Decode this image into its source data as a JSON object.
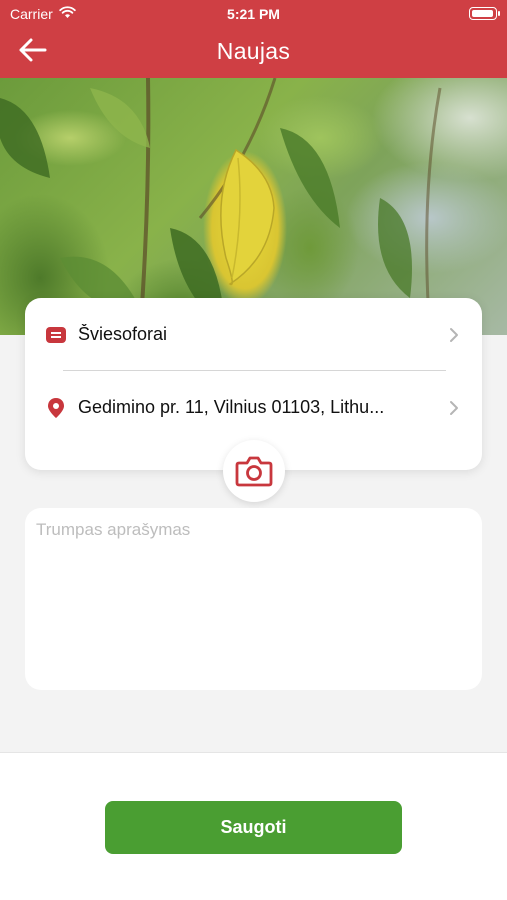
{
  "status_bar": {
    "carrier": "Carrier",
    "time": "5:21 PM",
    "battery_level": 1.0
  },
  "header": {
    "title": "Naujas",
    "back_icon": "arrow-left-icon",
    "background_color": "#cf3f44"
  },
  "hero": {
    "image_subject": "green leaves with yellow leaf"
  },
  "form": {
    "category": {
      "icon": "category-tag-icon",
      "value": "Šviesoforai"
    },
    "address": {
      "icon": "location-pin-icon",
      "value": "Gedimino pr. 11, Vilnius 01103, Lithu..."
    },
    "camera": {
      "icon": "camera-icon"
    },
    "description": {
      "placeholder": "Trumpas aprašymas",
      "value": ""
    }
  },
  "footer": {
    "save_label": "Saugoti",
    "save_color": "#4a9e32"
  },
  "colors": {
    "accent_red": "#c8373d",
    "background": "#f3f3f3"
  }
}
